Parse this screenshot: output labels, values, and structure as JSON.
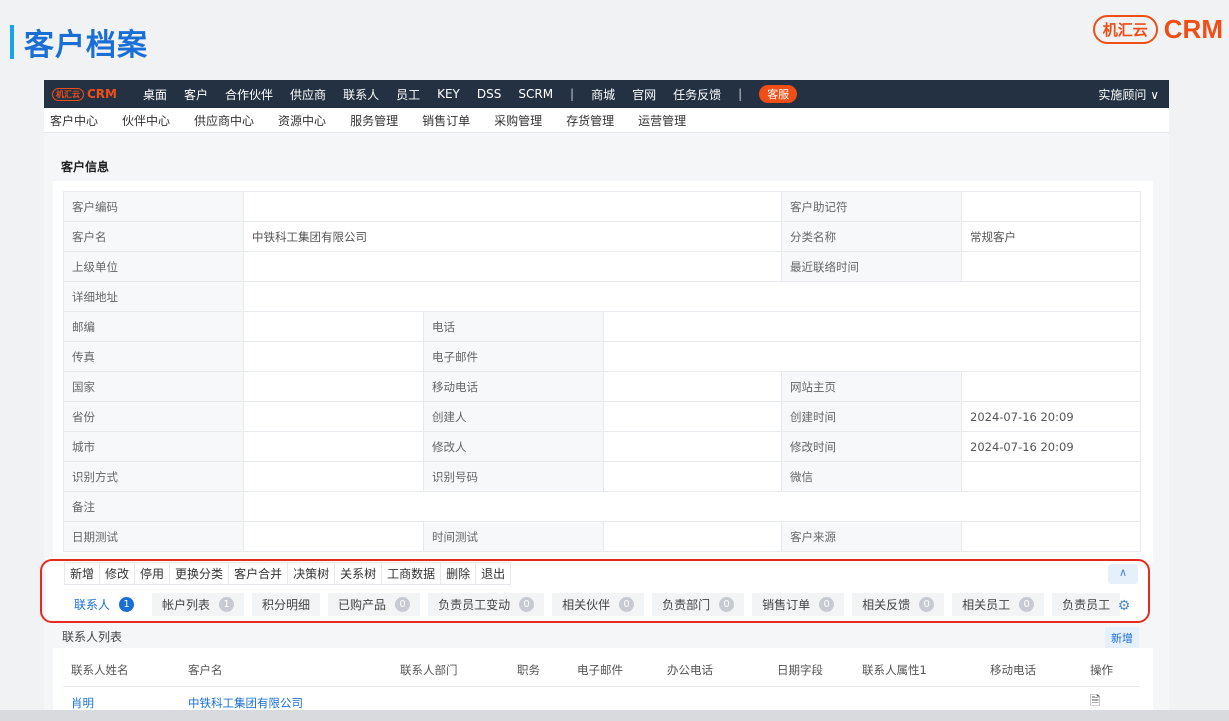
{
  "page": {
    "title": "客户档案",
    "brand_mark": "机汇云",
    "brand_text": "CRM"
  },
  "topnav": {
    "logo_mark": "机汇云",
    "logo_text": "CRM",
    "items": [
      "桌面",
      "客户",
      "合作伙伴",
      "供应商",
      "联系人",
      "员工",
      "KEY",
      "DSS",
      "SCRM",
      "|",
      "商城",
      "官网",
      "任务反馈",
      "|"
    ],
    "kefu": "客服",
    "user": "实施顾问 ∨"
  },
  "subnav": [
    "客户中心",
    "伙伴中心",
    "供应商中心",
    "资源中心",
    "服务管理",
    "销售订单",
    "采购管理",
    "存货管理",
    "运营管理"
  ],
  "section_title": "客户信息",
  "info": {
    "r1": [
      "客户编码",
      "",
      "客户助记符",
      ""
    ],
    "r2": [
      "客户名",
      "中铁科工集团有限公司",
      "分类名称",
      "常规客户"
    ],
    "r3": [
      "上级单位",
      "",
      "最近联络时间",
      ""
    ],
    "r4": [
      "详细地址",
      ""
    ],
    "r5": [
      "邮编",
      "",
      "电话",
      ""
    ],
    "r6": [
      "传真",
      "",
      "电子邮件",
      ""
    ],
    "r7": [
      "国家",
      "",
      "移动电话",
      "",
      "网站主页",
      ""
    ],
    "r8": [
      "省份",
      "",
      "创建人",
      "",
      "创建时间",
      "2024-07-16 20:09"
    ],
    "r9": [
      "城市",
      "",
      "修改人",
      "",
      "修改时间",
      "2024-07-16 20:09"
    ],
    "r10": [
      "识别方式",
      "",
      "识别号码",
      "",
      "微信",
      ""
    ],
    "r11": [
      "备注",
      ""
    ],
    "r12": [
      "日期测试",
      "",
      "时间测试",
      "",
      "客户来源",
      ""
    ]
  },
  "actions": [
    "新增",
    "修改",
    "停用",
    "更换分类",
    "客户合并",
    "决策树",
    "关系树",
    "工商数据",
    "删除",
    "退出"
  ],
  "collapse_icon": "chevron-up-icon",
  "tabs": [
    {
      "label": "联系人",
      "count": "1"
    },
    {
      "label": "帐户列表",
      "count": "1"
    },
    {
      "label": "积分明细",
      "count": ""
    },
    {
      "label": "已购产品",
      "count": "0"
    },
    {
      "label": "负责员工变动",
      "count": "0"
    },
    {
      "label": "相关伙伴",
      "count": "0"
    },
    {
      "label": "负责部门",
      "count": "0"
    },
    {
      "label": "销售订单",
      "count": "0"
    },
    {
      "label": "相关反馈",
      "count": "0"
    },
    {
      "label": "相关员工",
      "count": "0"
    },
    {
      "label": "负责员工",
      "count": ""
    }
  ],
  "contacts": {
    "title": "联系人列表",
    "add_label": "新增",
    "headers": [
      "联系人姓名",
      "客户名",
      "联系人部门",
      "职务",
      "电子邮件",
      "办公电话",
      "日期字段",
      "联系人属性1",
      "移动电话",
      "操作"
    ],
    "rows": [
      [
        "肖明",
        "中铁科工集团有限公司",
        "",
        "",
        "",
        "",
        "",
        "",
        "",
        ""
      ]
    ]
  },
  "colors": {
    "accent": "#1a6fd6",
    "brand": "#f04e17",
    "nav_bg": "#233142",
    "highlight": "#e52b1f"
  }
}
